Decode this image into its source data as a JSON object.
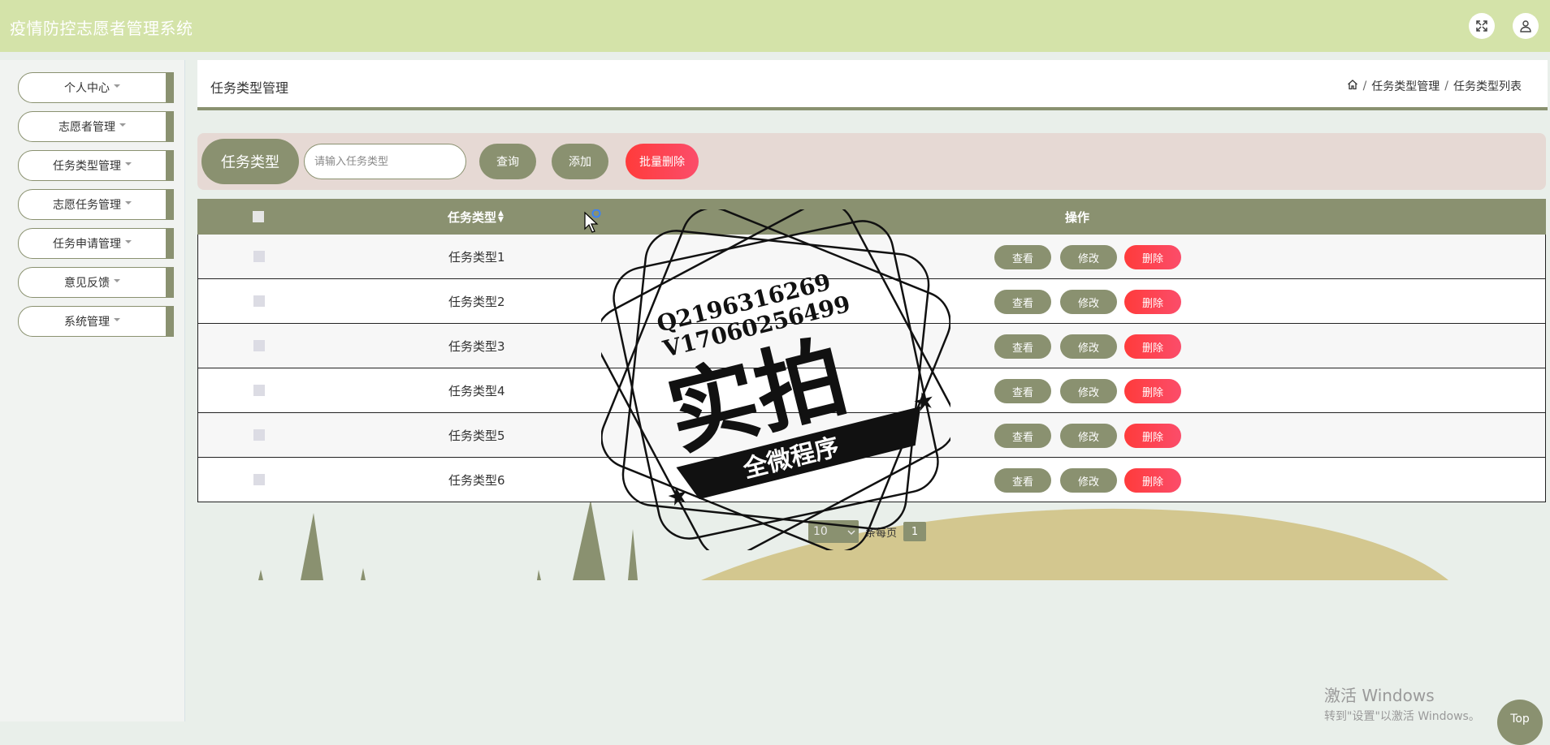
{
  "header": {
    "app_title": "疫情防控志愿者管理系统",
    "icons": [
      "fullscreen-icon",
      "user-icon"
    ]
  },
  "sidebar": {
    "items": [
      {
        "label": "个人中心"
      },
      {
        "label": "志愿者管理"
      },
      {
        "label": "任务类型管理"
      },
      {
        "label": "志愿任务管理"
      },
      {
        "label": "任务申请管理"
      },
      {
        "label": "意见反馈"
      },
      {
        "label": "系统管理"
      }
    ]
  },
  "breadcrumb": {
    "title": "任务类型管理",
    "crumb_1": "任务类型管理",
    "crumb_2": "任务类型列表",
    "sep": "/"
  },
  "search": {
    "label": "任务类型",
    "placeholder": "请输入任务类型",
    "value": "",
    "query_label": "查询",
    "add_label": "添加",
    "batch_delete_label": "批量删除"
  },
  "table": {
    "columns": {
      "name": "任务类型",
      "ops": "操作"
    },
    "rows": [
      {
        "name": "任务类型1"
      },
      {
        "name": "任务类型2"
      },
      {
        "name": "任务类型3"
      },
      {
        "name": "任务类型4"
      },
      {
        "name": "任务类型5"
      },
      {
        "name": "任务类型6"
      }
    ],
    "view_label": "查看",
    "edit_label": "修改",
    "delete_label": "删除"
  },
  "pagination": {
    "page_size": "10",
    "per_page_suffix": "条每页",
    "current_page": "1"
  },
  "watermark": {
    "line1": "Q2196316269",
    "line2": "V17060256499",
    "big_text": "实拍",
    "banner_text": "全微程序"
  },
  "windows_activation": {
    "line1": "激活 Windows",
    "line2": "转到\"设置\"以激活 Windows。"
  },
  "top_button": {
    "label": "Top"
  },
  "colors": {
    "header_bg": "#d4e3a9",
    "accent": "#8a9170",
    "danger": "#ff3b3b",
    "search_panel_bg": "#e6d9d4",
    "page_bg": "#e9efea"
  }
}
